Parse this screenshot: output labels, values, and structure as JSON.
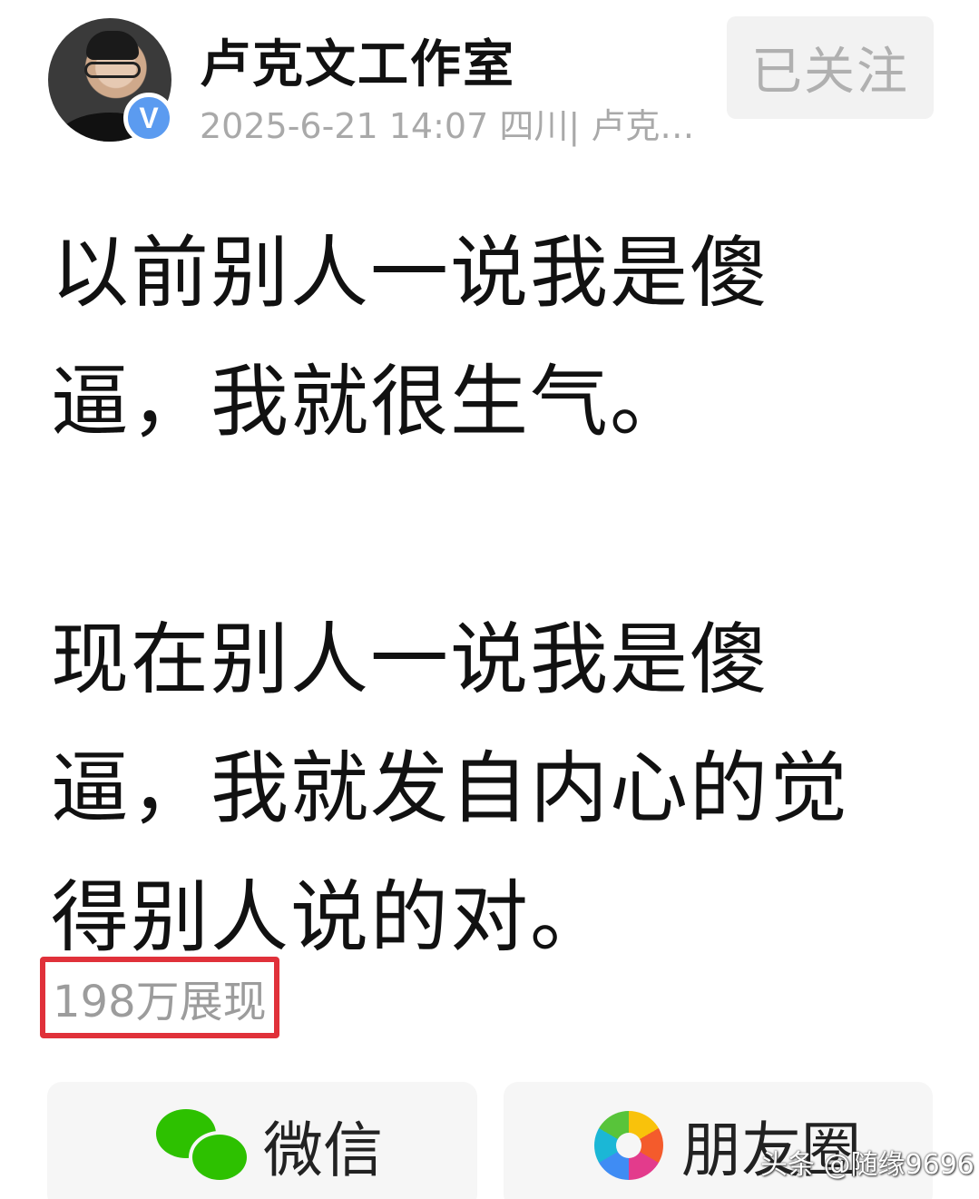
{
  "author": {
    "name": "卢克文工作室",
    "verified_badge": "V",
    "meta": "2025-6-21 14:07 四川| 卢克…"
  },
  "follow_button": {
    "label": "已关注"
  },
  "post": {
    "paragraph1": [
      "以前别人一说我是傻",
      "逼，我就很生气。"
    ],
    "paragraph2": [
      "现在别人一说我是傻",
      "逼，我就发自内心的觉",
      "得别人说的对。"
    ]
  },
  "impressions": "198万展现",
  "share": {
    "wechat_label": "微信",
    "moments_label": "朋友圈"
  },
  "watermark": "头条 @随缘9696",
  "colors": {
    "highlight_border": "#e0313a",
    "verified": "#5b9bf0",
    "wechat_green": "#2dc100"
  }
}
